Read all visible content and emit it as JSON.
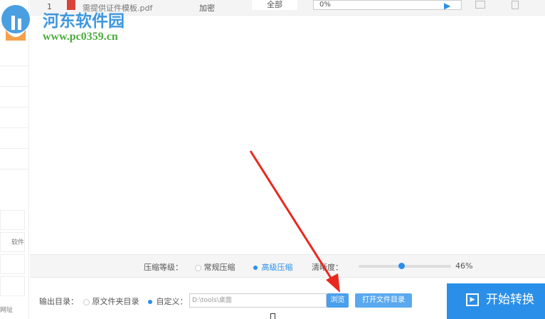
{
  "file_row": {
    "index": "1",
    "filename": "需提供证件模板.pdf",
    "mode": "加密",
    "pages": "全部",
    "progress": "0%"
  },
  "sidebar": {
    "items": [
      "软件",
      "网址"
    ]
  },
  "watermark": {
    "name": "河东软件园",
    "url": "www.pc0359.cn"
  },
  "compression": {
    "label": "压缩等级：",
    "options": [
      "常规压缩",
      "高级压缩"
    ],
    "selected": 1,
    "clarity_label": "清晰度：",
    "clarity_value": "46%",
    "clarity_fraction": 0.46
  },
  "output": {
    "label": "输出目录：",
    "options": [
      "原文件夹目录",
      "自定义："
    ],
    "selected": 1,
    "path": "D:\\tools\\桌面",
    "browse": "浏览",
    "open_dir": "打开文件目录"
  },
  "start_button": "开始转换",
  "colors": {
    "accent": "#2a8fe8",
    "arrow": "#e8281e"
  }
}
